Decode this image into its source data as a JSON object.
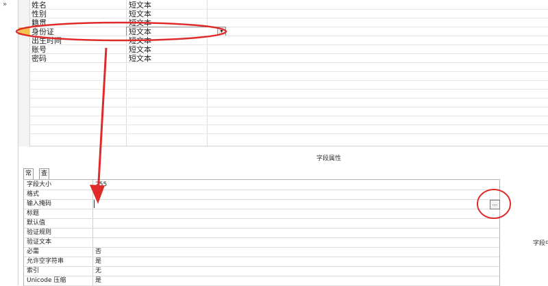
{
  "nav": {
    "collapse_glyph": "»"
  },
  "fields": [
    {
      "name": "姓名",
      "type": "短文本"
    },
    {
      "name": "性别",
      "type": "短文本"
    },
    {
      "name": "籍贯",
      "type": "短文本"
    },
    {
      "name": "身份证",
      "type": "短文本",
      "current": true
    },
    {
      "name": "出生时间",
      "type": "短文本"
    },
    {
      "name": "账号",
      "type": "短文本"
    },
    {
      "name": "密码",
      "type": "短文本"
    }
  ],
  "section_title": "字段属性",
  "tabs": [
    {
      "label": "常规",
      "active": true
    },
    {
      "label": "查阅"
    }
  ],
  "properties": [
    {
      "label": "字段大小",
      "value": "255"
    },
    {
      "label": "格式",
      "value": ""
    },
    {
      "label": "输入掩码",
      "value": ""
    },
    {
      "label": "标题",
      "value": ""
    },
    {
      "label": "默认值",
      "value": ""
    },
    {
      "label": "验证规则",
      "value": ""
    },
    {
      "label": "验证文本",
      "value": ""
    },
    {
      "label": "必需",
      "value": "否"
    },
    {
      "label": "允许空字符串",
      "value": "是"
    },
    {
      "label": "索引",
      "value": "无"
    },
    {
      "label": "Unicode 压缩",
      "value": "是"
    }
  ],
  "ellipsis_label": "...",
  "dropdown_glyph": "▾",
  "side_help": "字段中",
  "colors": {
    "annotation": "#e02a2a",
    "row_selector": "#f5c04d"
  }
}
